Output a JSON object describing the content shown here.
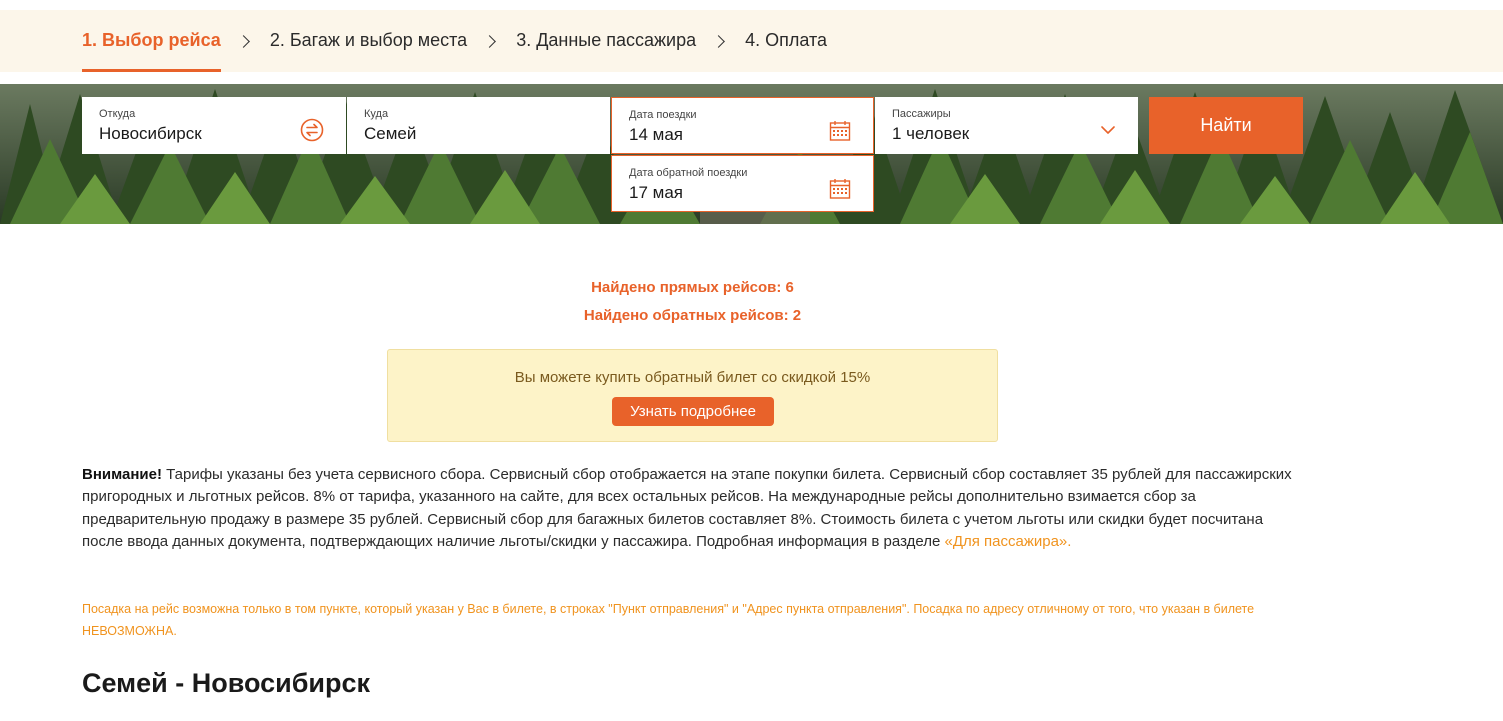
{
  "steps": [
    {
      "label": "1. Выбор рейса",
      "active": true
    },
    {
      "label": "2. Багаж и выбор места"
    },
    {
      "label": "3. Данные пассажира"
    },
    {
      "label": "4. Оплата"
    }
  ],
  "search": {
    "from_label": "Откуда",
    "from_value": "Новосибирск",
    "to_label": "Куда",
    "to_value": "Семей",
    "date_label": "Дата поездки",
    "date_value": "14 мая",
    "return_label": "Дата обратной поездки",
    "return_value": "17 мая",
    "pax_label": "Пассажиры",
    "pax_value": "1 человек",
    "find_button": "Найти"
  },
  "results": {
    "direct": "Найдено прямых рейсов:  6",
    "return": "Найдено обратных рейсов:  2"
  },
  "promo": {
    "text": "Вы можете купить обратный билет со скидкой 15%",
    "button": "Узнать подробнее"
  },
  "notice": {
    "bold": "Внимание!",
    "text": " Тарифы указаны без учета сервисного сбора. Сервисный сбор отображается на этапе покупки билета. Сервисный сбор составляет 35 рублей для пассажирских пригородных и льготных рейсов. 8% от тарифа, указанного на сайте, для всех остальных рейсов. На международные рейсы дополнительно взимается сбор за предварительную продажу в размере 35 рублей. Сервисный сбор для багажных билетов составляет 8%. Стоимость билета с учетом льготы или скидки будет посчитана после ввода данных документа, подтверждающих наличие льготы/скидки у пассажира. Подробная информация в разделе ",
    "link": "«Для пассажира»."
  },
  "boarding": "Посадка на рейс возможна только в том пункте, который указан у Вас в билете, в строках \"Пункт отправления\" и \"Адрес пункта отправления\". Посадка по адресу отличному от того, что указан в билете НЕВОЗМОЖНА.",
  "route_title": "Семей - Новосибирск",
  "colors": {
    "accent": "#e8622a",
    "link": "#f0931e",
    "promo_bg": "#fdf3c8"
  }
}
